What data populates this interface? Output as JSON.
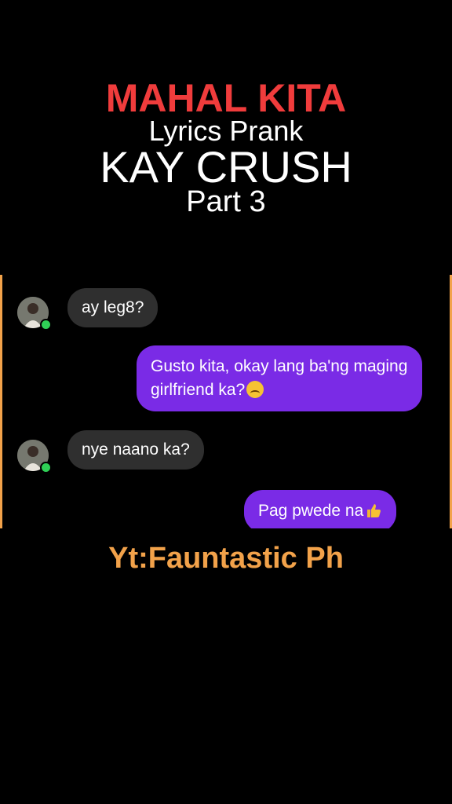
{
  "overlay": {
    "line1": "MAHAL KITA",
    "line2": "Lyrics Prank",
    "line3": "KAY CRUSH",
    "line4": "Part 3",
    "watermark": "Yt:Fauntastic Ph"
  },
  "messages": [
    {
      "from": "contact",
      "text": "ay leg8?"
    },
    {
      "from": "me",
      "text": "Gusto kita, okay lang ba'ng maging girlfriend ka?",
      "emoji": "upside-down-face-icon"
    },
    {
      "from": "contact",
      "text": "nye naano ka?"
    },
    {
      "from": "me",
      "text": "Pag pwede na",
      "emoji": "thumbs-up-icon"
    }
  ],
  "colors": {
    "title_accent": "#f03c3c",
    "watermark": "#f2a24a",
    "outgoing_bubble": "#7a2be6",
    "incoming_bubble": "#2f2f2f",
    "online_dot": "#2fd056"
  }
}
